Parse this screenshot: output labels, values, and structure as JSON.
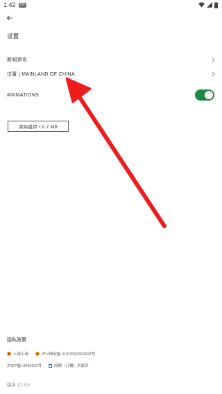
{
  "status_bar": {
    "time": "1:42",
    "notification_badge": "GB"
  },
  "header": {
    "back_icon": "arrow-left-icon",
    "title": "设置"
  },
  "settings": {
    "news_label": "新闻资讯",
    "location_label": "位置 | MAINLAND OF CHINA",
    "animations_label": "ANIMATIONS",
    "animations_enabled": true,
    "clear_cache_label": "清除缓存 • 0.7 MB"
  },
  "footer": {
    "privacy": "隐私政策",
    "icp_shanghai": "上海工商",
    "police_record": "沪公网安备 31010502001524号",
    "icp_number": "沪ICP备12009622号",
    "report_label": "网购（订餐）大家评",
    "version": "版本 17.5.0"
  },
  "colors": {
    "toggle_on": "#1a8a3e",
    "annotation": "#ee1c1c"
  }
}
